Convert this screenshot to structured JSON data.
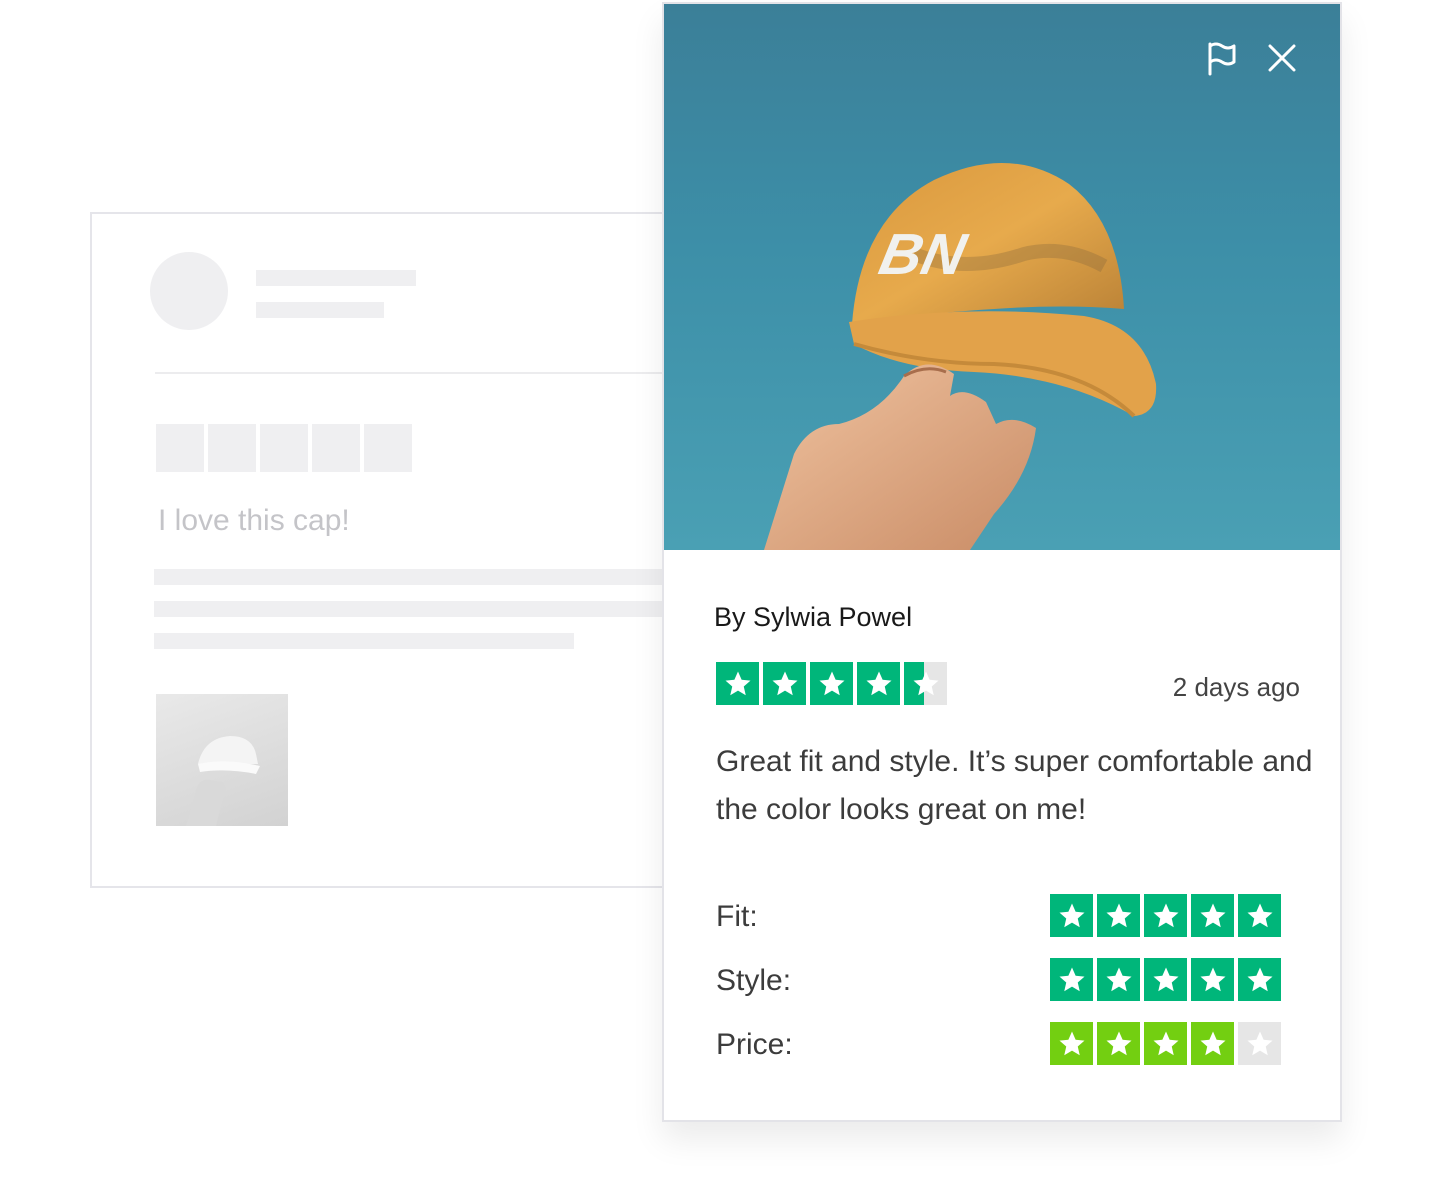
{
  "background_card": {
    "title": "I love this cap!"
  },
  "modal": {
    "photo": {
      "subject": "hand holding a yellow cap with BN logo against blue sky",
      "cap_logo": "BN",
      "sky_color": "#3d8fa8",
      "cap_color": "#e7a948"
    },
    "icons": {
      "flag": "flag-icon",
      "close": "close-icon"
    },
    "author": "By Sylwia Powel",
    "overall_rating": 4.5,
    "date": "2 days ago",
    "body": "Great fit and style. It’s super comfortable and the color looks great on me!",
    "attributes": [
      {
        "label": "Fit:",
        "rating": 5
      },
      {
        "label": "Style:",
        "rating": 5
      },
      {
        "label": "Price:",
        "rating": 4
      }
    ],
    "colors": {
      "star_green": "#00b67a",
      "star_light_green": "#73cf11",
      "star_empty": "#e6e6e6"
    }
  }
}
